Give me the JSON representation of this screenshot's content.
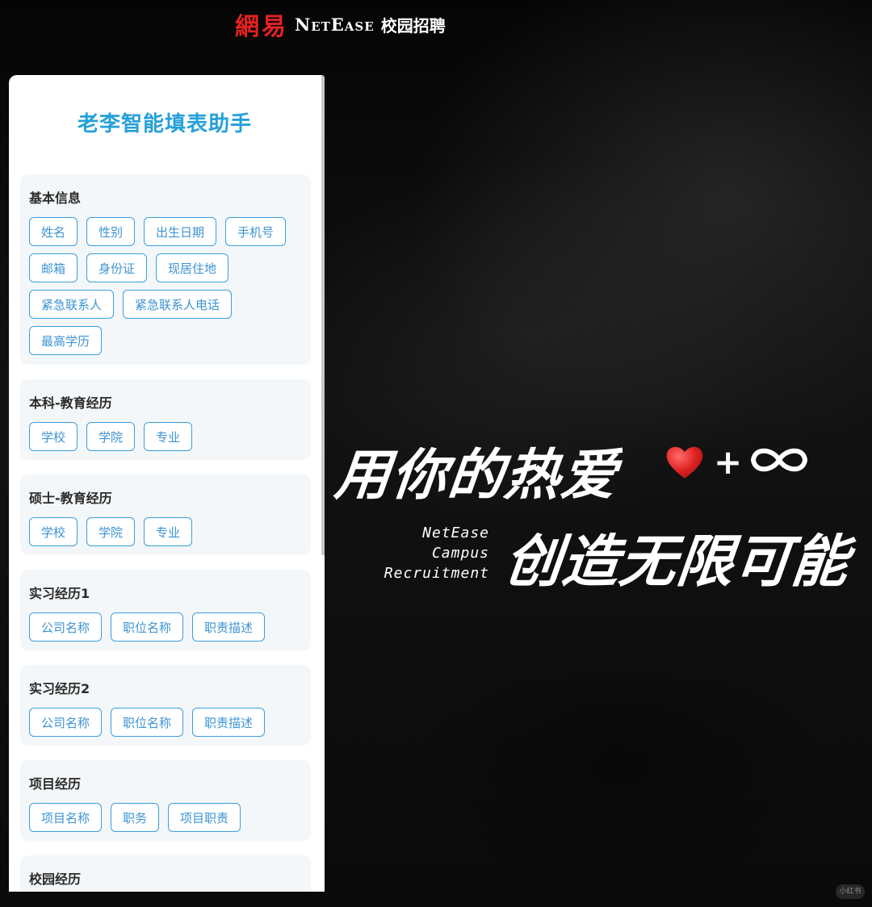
{
  "brand": {
    "cn": "網易",
    "en": "NetEase",
    "sub": "校园招聘"
  },
  "panel": {
    "title": "老李智能填表助手",
    "sections": [
      {
        "title": "基本信息",
        "chips": [
          "姓名",
          "性别",
          "出生日期",
          "手机号",
          "邮箱",
          "身份证",
          "现居住地",
          "紧急联系人",
          "紧急联系人电话",
          "最高学历"
        ]
      },
      {
        "title": "本科-教育经历",
        "chips": [
          "学校",
          "学院",
          "专业"
        ]
      },
      {
        "title": "硕士-教育经历",
        "chips": [
          "学校",
          "学院",
          "专业"
        ]
      },
      {
        "title": "实习经历1",
        "chips": [
          "公司名称",
          "职位名称",
          "职责描述"
        ]
      },
      {
        "title": "实习经历2",
        "chips": [
          "公司名称",
          "职位名称",
          "职责描述"
        ]
      },
      {
        "title": "项目经历",
        "chips": [
          "项目名称",
          "职务",
          "项目职责"
        ]
      },
      {
        "title": "校园经历",
        "chips": []
      }
    ]
  },
  "slogan": {
    "line1": "用你的热爱",
    "plus": "+",
    "campus_lines": [
      "NetEase",
      "Campus",
      "Recruitment"
    ],
    "line2": "创造无限可能"
  },
  "icons": {
    "heart": "heart-icon",
    "infinity": "infinity-icon"
  },
  "colors": {
    "brand_red": "#e52122",
    "accent_blue": "#26a0d8",
    "chip_border": "#3a9ee0",
    "heart_red": "#e02424"
  },
  "watermark": "小红书"
}
